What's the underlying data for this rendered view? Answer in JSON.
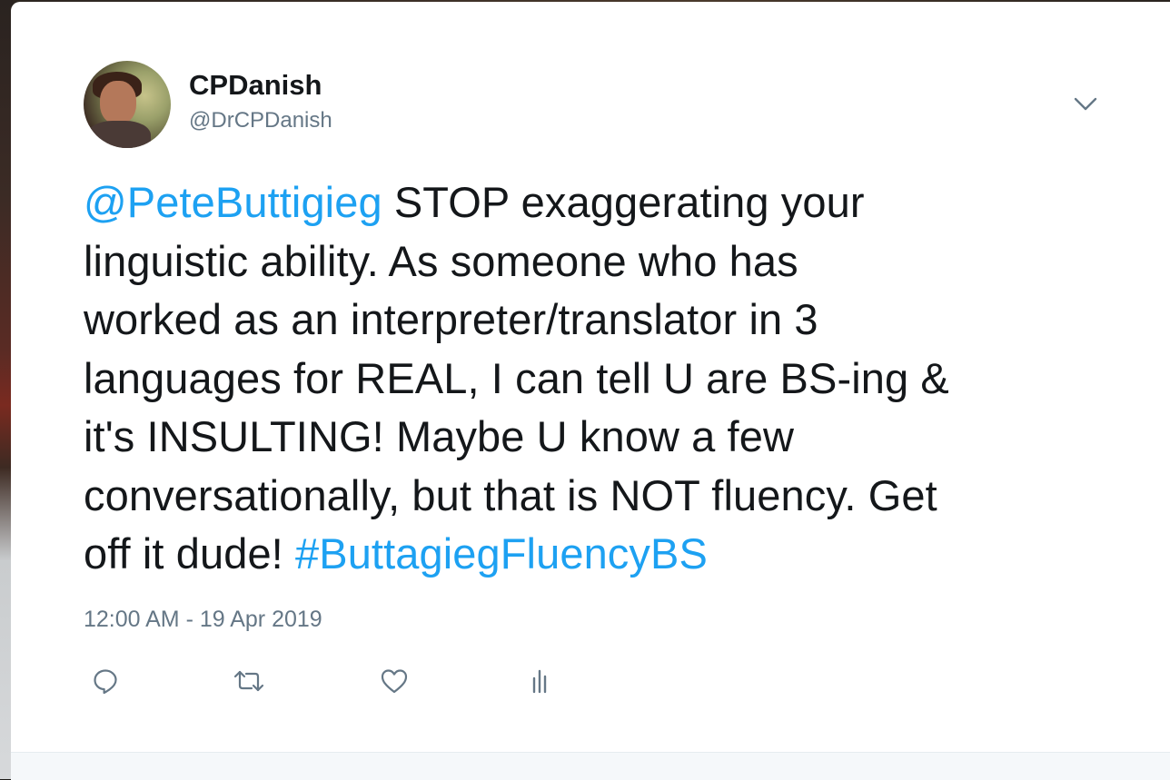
{
  "tweet": {
    "display_name": "CPDanish",
    "handle": "@DrCPDanish",
    "text_lines": [
      [
        {
          "text": "@PeteButtigieg",
          "link": true
        },
        {
          "text": " STOP exaggerating your",
          "link": false
        }
      ],
      [
        {
          "text": "linguistic ability. As someone who has",
          "link": false
        }
      ],
      [
        {
          "text": "worked as an interpreter/translator in 3",
          "link": false
        }
      ],
      [
        {
          "text": "languages for REAL, I can tell U are BS-ing &",
          "link": false
        }
      ],
      [
        {
          "text": "it's INSULTING! Maybe U know a few",
          "link": false
        }
      ],
      [
        {
          "text": "conversationally, but that is NOT fluency. Get",
          "link": false
        }
      ],
      [
        {
          "text": "off it dude! ",
          "link": false
        },
        {
          "text": "#ButtagiegFluencyBS",
          "link": true
        }
      ]
    ],
    "timestamp": "12:00 AM - 19 Apr 2019"
  },
  "icons": {
    "menu": "chevron-down-icon",
    "reply": "reply-icon",
    "retweet": "retweet-icon",
    "like": "heart-icon",
    "analytics": "analytics-icon"
  },
  "colors": {
    "link": "#1da1f2",
    "text": "#14171a",
    "secondary": "#657786"
  }
}
